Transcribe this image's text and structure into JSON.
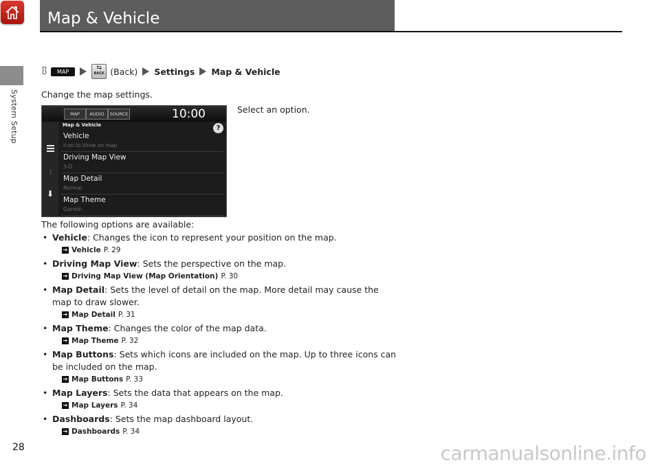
{
  "header": {
    "home_icon": "home-icon",
    "title": "Map & Vehicle"
  },
  "sidebar": {
    "section_label": "System Setup"
  },
  "path": {
    "voice_icon": "voice-command-icon",
    "map_button": "MAP",
    "back_icon_label": "BACK",
    "back_text": "(Back)",
    "step1": "Settings",
    "step2": "Map & Vehicle"
  },
  "intro": "Change the map settings.",
  "screen": {
    "tabs": [
      "MAP",
      "AUDIO",
      "SOURCE"
    ],
    "clock": "10:00",
    "heading": "Map & Vehicle",
    "help": "?",
    "rows": [
      {
        "title": "Vehicle",
        "sub": "Icon to show on map"
      },
      {
        "title": "Driving Map View",
        "sub": "3-D"
      },
      {
        "title": "Map Detail",
        "sub": "Normal"
      },
      {
        "title": "Map Theme",
        "sub": "Garmin"
      }
    ]
  },
  "select_instruction": "Select an option.",
  "options_lead": "The following options are available:",
  "options": [
    {
      "name": "Vehicle",
      "desc": ": Changes the icon to represent your position on the map.",
      "ref": "Vehicle",
      "page": "P. 29"
    },
    {
      "name": "Driving Map View",
      "desc": ": Sets the perspective on the map.",
      "ref": "Driving Map View (Map Orientation)",
      "page": "P. 30"
    },
    {
      "name": "Map Detail",
      "desc": ": Sets the level of detail on the map. More detail may cause the map to draw slower.",
      "ref": "Map Detail",
      "page": "P. 31"
    },
    {
      "name": "Map Theme",
      "desc": ": Changes the color of the map data.",
      "ref": "Map Theme",
      "page": "P. 32"
    },
    {
      "name": "Map Buttons",
      "desc": ": Sets which icons are included on the map. Up to three icons can be included on the map.",
      "ref": "Map Buttons",
      "page": "P. 33"
    },
    {
      "name": "Map Layers",
      "desc": ": Sets the data that appears on the map.",
      "ref": "Map Layers",
      "page": "P. 34"
    },
    {
      "name": "Dashboards",
      "desc": ": Sets the map dashboard layout.",
      "ref": "Dashboards",
      "page": "P. 34"
    }
  ],
  "footer": {
    "page_number": "28",
    "watermark": "carmanualsonline.info"
  }
}
